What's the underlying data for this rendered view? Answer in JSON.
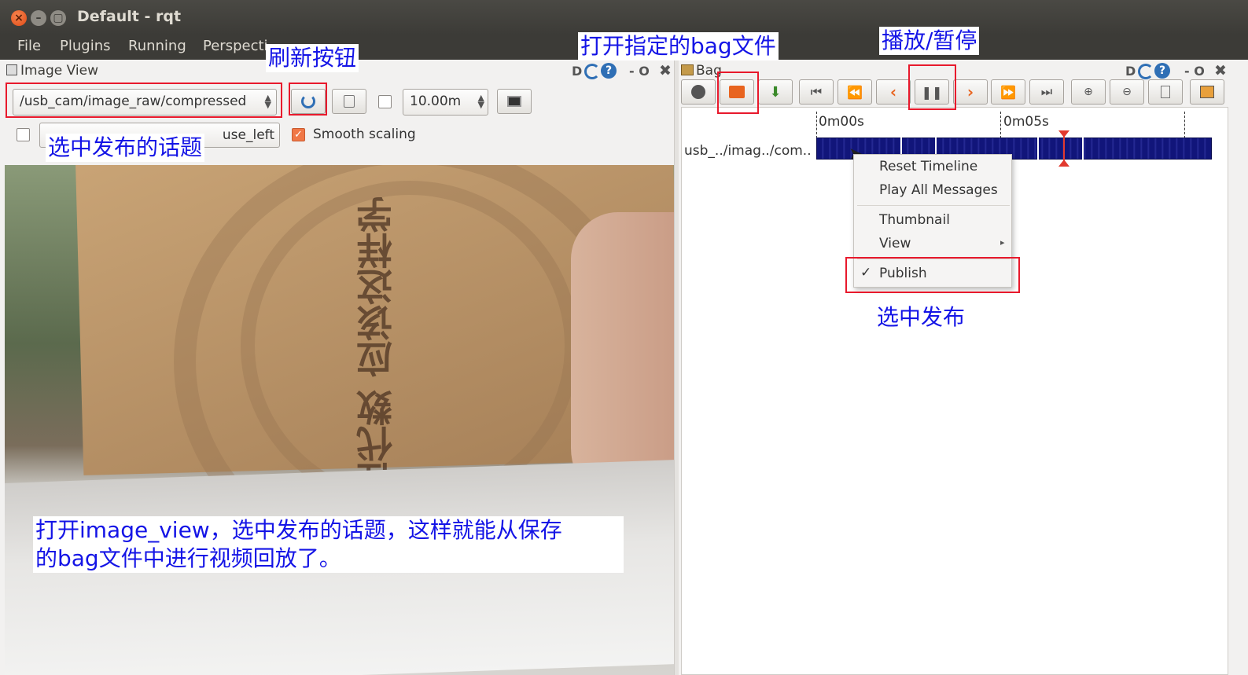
{
  "window": {
    "title": "Default - rqt"
  },
  "menubar": {
    "items": [
      "File",
      "Plugins",
      "Running",
      "Perspecti"
    ]
  },
  "image_view": {
    "title": "Image View",
    "controls_right": "D",
    "controls_tail": "- O",
    "topic": "/usb_cam/image_raw/compressed",
    "rate_value": "10.00m",
    "mouse_field_value": "use_left",
    "smooth_scaling_label": "Smooth scaling",
    "book_title": "线性代数 应该这样学"
  },
  "bag": {
    "title": "Bag",
    "controls_right": "D",
    "controls_tail": "- O",
    "time_labels": [
      "0m00s",
      "0m05s"
    ],
    "topic_label": "usb_../imag../com..",
    "context_menu": {
      "items": [
        "Reset Timeline",
        "Play All Messages",
        "Thumbnail",
        "View",
        "Publish"
      ],
      "publish_checked": true
    }
  },
  "annotations": {
    "refresh": "刷新按钮",
    "open_bag": "打开指定的bag文件",
    "play_pause": "播放/暂停",
    "select_topic": "选中发布的话题",
    "select_publish": "选中发布",
    "note_line1": "打开image_view，选中发布的话题，这样就能从保存",
    "note_line2": "的bag文件中进行视频回放了。"
  },
  "colors": {
    "annotation_text": "#1414e6",
    "annotation_box": "#e8192c",
    "timeline": "#11157a",
    "playhead": "#e23a2f"
  }
}
